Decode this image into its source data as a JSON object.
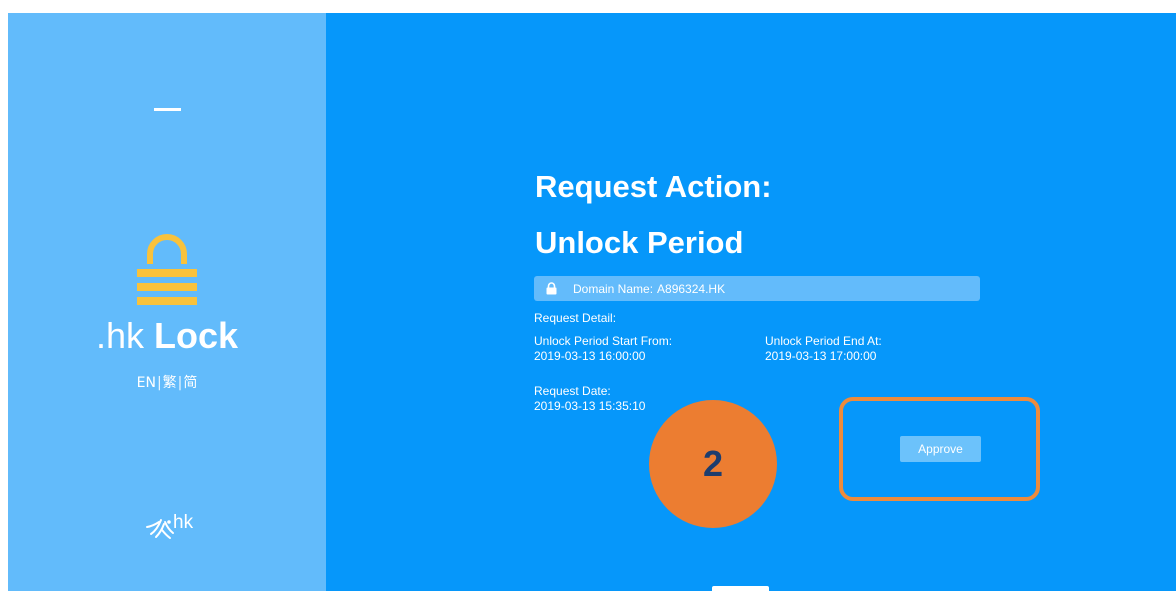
{
  "sidebar": {
    "brand_prefix": ".hk",
    "brand_name": "Lock",
    "languages": [
      "EN",
      "繁",
      "简"
    ],
    "separator": "|",
    "logo_text": "hk",
    "accent_color": "#f9c23c"
  },
  "main": {
    "title_line1": "Request Action:",
    "title_line2": "Unlock Period",
    "domain_label": "Domain Name:",
    "domain_value": "A896324.HK",
    "request_detail_label": "Request Detail:",
    "start_label": "Unlock Period Start From:",
    "start_value": "2019-03-13 16:00:00",
    "end_label": "Unlock Period End At:",
    "end_value": "2019-03-13 17:00:00",
    "request_date_label": "Request Date:",
    "request_date_value": "2019-03-13 15:35:10",
    "approve_label": "Approve"
  },
  "annotation": {
    "step_number": "2",
    "badge_color": "#ec7d31"
  }
}
